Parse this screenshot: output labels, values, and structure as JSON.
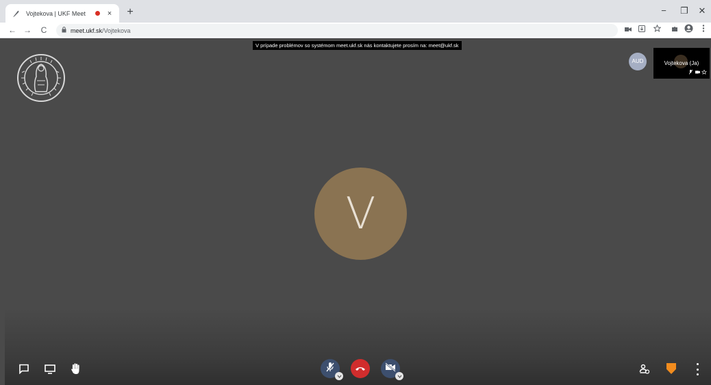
{
  "browser": {
    "tab": {
      "title": "Vojtekova | UKF Meet",
      "close": "×"
    },
    "new_tab": "+",
    "window": {
      "minimize": "−",
      "restore": "❐",
      "close": "✕"
    },
    "nav": {
      "back": "←",
      "forward": "→",
      "reload": "C"
    },
    "address": {
      "host": "meet.ukf.sk",
      "path": "/Vojtekova"
    }
  },
  "meeting": {
    "notice": "V prípade problémov so systémom meet.ukf.sk nás kontaktujete prosím na: meet@ukf.sk",
    "main_avatar_letter": "V",
    "participant_badge": "AUD",
    "self_view_name": "Vojtekova (Ja)",
    "colors": {
      "avatar": "#8a7352",
      "hangup": "#d12d2d",
      "control": "#3d4f6e",
      "shield": "#f28c1e"
    }
  },
  "icons": {
    "chat": "chat-icon",
    "screen_share": "screen-share-icon",
    "raise_hand": "raise-hand-icon",
    "microphone_muted": "microphone-muted-icon",
    "hangup": "hangup-icon",
    "camera_off": "camera-off-icon",
    "participants": "participants-icon",
    "security": "security-shield-icon",
    "more": "more-options-icon"
  }
}
